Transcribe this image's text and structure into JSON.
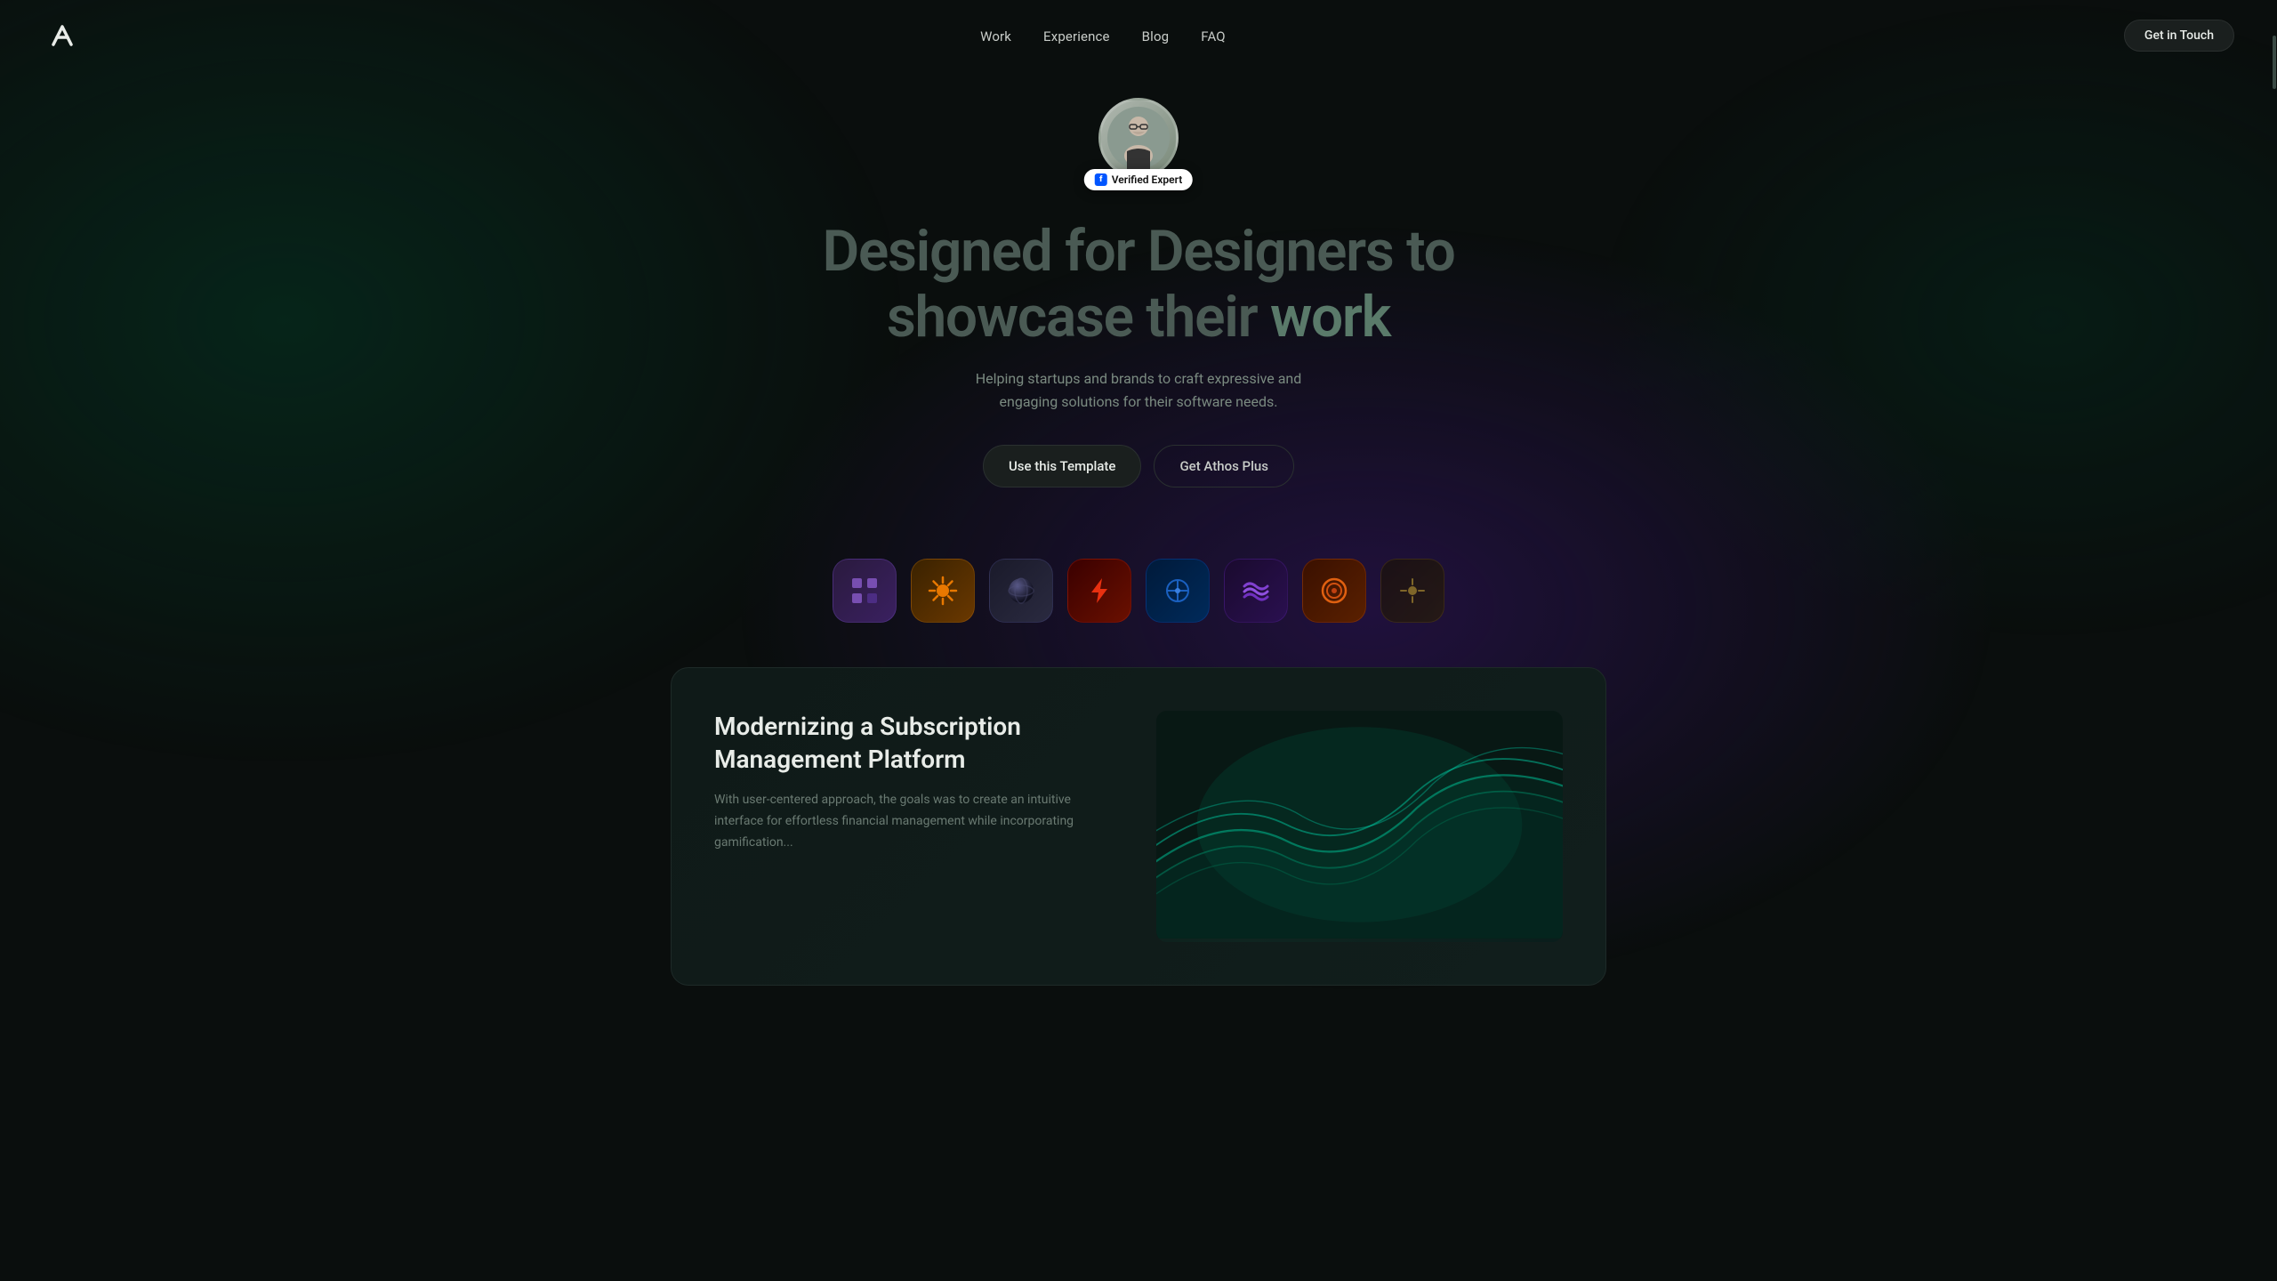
{
  "nav": {
    "logo_alt": "Logo",
    "links": [
      {
        "label": "Work",
        "href": "#"
      },
      {
        "label": "Experience",
        "href": "#"
      },
      {
        "label": "Blog",
        "href": "#"
      },
      {
        "label": "FAQ",
        "href": "#"
      }
    ],
    "cta_label": "Get in Touch"
  },
  "hero": {
    "avatar_alt": "Profile photo",
    "verified_label": "Verified Expert",
    "title_line1": "Designed for Designers to",
    "title_line2_start": "showcase their ",
    "title_line2_accent": "work",
    "subtitle": "Helping startups and brands to craft expressive and engaging solutions for their software needs.",
    "btn_primary": "Use this Template",
    "btn_secondary": "Get Athos Plus"
  },
  "icons": [
    {
      "id": "icon-1",
      "label": "Purple Grid App",
      "class": "icon-purple-grid",
      "symbol": "⠿"
    },
    {
      "id": "icon-2",
      "label": "Sun App",
      "class": "icon-orange-sun",
      "symbol": "✳"
    },
    {
      "id": "icon-3",
      "label": "Sphere App",
      "class": "icon-dark-sphere",
      "symbol": "⬤"
    },
    {
      "id": "icon-4",
      "label": "Bolt App",
      "class": "icon-red-bolt",
      "symbol": "⚡"
    },
    {
      "id": "icon-5",
      "label": "Dots App",
      "class": "icon-blue-dots",
      "symbol": "✦"
    },
    {
      "id": "icon-6",
      "label": "Wave App",
      "class": "icon-purple-wave",
      "symbol": "〜"
    },
    {
      "id": "icon-7",
      "label": "Ring App",
      "class": "icon-orange-ring",
      "symbol": "◉"
    },
    {
      "id": "icon-8",
      "label": "Dot App",
      "class": "icon-yellow-dot",
      "symbol": "✤"
    }
  ],
  "project_card": {
    "title": "Modernizing a Subscription Management Platform",
    "description": "With user-centered approach, the goals was to create an intuitive interface for effortless financial management while incorporating gamification..."
  }
}
